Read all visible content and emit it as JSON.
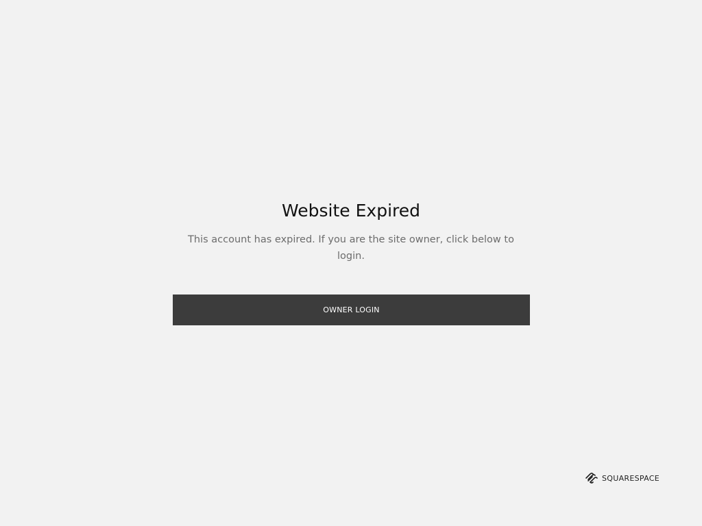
{
  "main": {
    "title": "Website Expired",
    "message": "This account has expired. If you are the site owner, click below to login.",
    "login_button_label": "OWNER LOGIN"
  },
  "footer": {
    "brand_name": "SQUARESPACE",
    "brand_icon": "squarespace-logo-icon"
  },
  "colors": {
    "background": "#f2f2f2",
    "button": "#3c3c3c",
    "title": "#111111",
    "message": "#6c6c6c"
  }
}
